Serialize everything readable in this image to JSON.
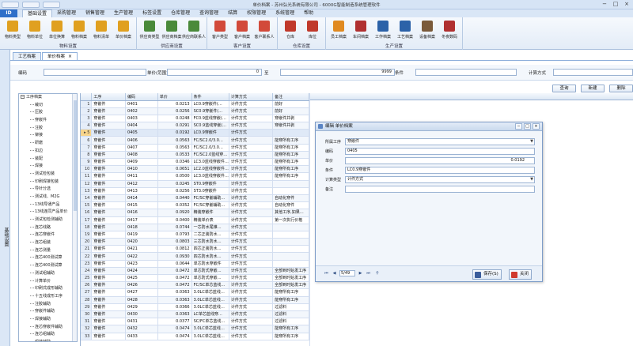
{
  "window": {
    "title": "单价档案 - 苏州弘光系统有限公司 - 6000G智能制造系统管理软件",
    "controls": [
      "−",
      "□",
      "×"
    ]
  },
  "menubar": {
    "app_button": "ID",
    "items": [
      "基础设置",
      "采购管理",
      "销售管理",
      "生产管理",
      "标签设置",
      "仓库管理",
      "查询管理",
      "结算",
      "权限管理",
      "系统管理",
      "帮助"
    ]
  },
  "ribbon": {
    "groups": [
      {
        "label": "物料设置",
        "buttons": [
          {
            "label": "物料类型",
            "icon": "folder-icon",
            "color": "#e0a020"
          },
          {
            "label": "物料单位",
            "icon": "folder-icon",
            "color": "#e0a020"
          },
          {
            "label": "单位换算",
            "icon": "folder-icon",
            "color": "#e0a020"
          },
          {
            "label": "物料档案",
            "icon": "folder-icon",
            "color": "#e0a020"
          },
          {
            "label": "物料清单",
            "icon": "folder-icon",
            "color": "#e0a020"
          },
          {
            "label": "单价档案",
            "icon": "folder-icon",
            "color": "#e0a020"
          }
        ]
      },
      {
        "label": "供应商设置",
        "buttons": [
          {
            "label": "供应商类型",
            "icon": "truck-icon",
            "color": "#4a8a3a"
          },
          {
            "label": "供应商档案",
            "icon": "truck-icon",
            "color": "#4a8a3a"
          },
          {
            "label": "供应商联系人",
            "icon": "truck-icon",
            "color": "#4a8a3a"
          }
        ]
      },
      {
        "label": "客户设置",
        "buttons": [
          {
            "label": "客户类型",
            "icon": "people-icon",
            "color": "#d24a3a"
          },
          {
            "label": "客户档案",
            "icon": "people-icon",
            "color": "#d24a3a"
          },
          {
            "label": "客户联系人",
            "icon": "people-icon",
            "color": "#d24a3a"
          }
        ]
      },
      {
        "label": "仓库设置",
        "buttons": [
          {
            "label": "仓库",
            "icon": "house-icon",
            "color": "#c0392b"
          },
          {
            "label": "库位",
            "icon": "house-icon",
            "color": "#c0392b"
          }
        ]
      },
      {
        "label": "生产设置",
        "buttons": [
          {
            "label": "员工档案",
            "icon": "person-icon",
            "color": "#e08a20"
          },
          {
            "label": "车间档案",
            "icon": "book-icon",
            "color": "#b03030"
          },
          {
            "label": "工作档案",
            "icon": "book-icon",
            "color": "#2c62a8"
          },
          {
            "label": "工艺档案",
            "icon": "book-icon",
            "color": "#2c62a8"
          },
          {
            "label": "设备档案",
            "icon": "book-icon",
            "color": "#7a5a3a"
          },
          {
            "label": "冬夜数码",
            "icon": "book-icon",
            "color": "#b03030"
          }
        ]
      }
    ]
  },
  "sidebar": {
    "label": "基础设置"
  },
  "doc_tabs": [
    {
      "label": "工艺档案",
      "active": false
    },
    {
      "label": "单价档案",
      "active": true
    }
  ],
  "filter": {
    "code_label": "编码",
    "price_range_label": "单价(范围)",
    "price_from": "0",
    "to_label": "至",
    "price_to": "9999",
    "condition_label": "条件",
    "calc_method_label": "计算方式"
  },
  "actions": [
    "查询",
    "新建",
    "删除"
  ],
  "tree": {
    "root": "工序档案",
    "children": [
      "裁切",
      "压胶",
      "穿嵌件",
      "注胶",
      "铆接",
      "研磨",
      "扣边",
      "装配",
      "焊接",
      "测试检包装",
      "印刷焊接包装",
      "导针分选",
      "测试线、M2G",
      "13线导通产品",
      "13线连同产品单价",
      "测试包检测辅助",
      "连芯线路",
      "连芯穿嵌件",
      "连芯组装",
      "连芯测量",
      "连芯400测试算",
      "连芯400测试算",
      "测试组辅助",
      "计算单价",
      "印刷式成形辅助",
      "十五线成形工序",
      "注胶辅助",
      "穿嵌件辅助",
      "焊接辅助",
      "连芯穿嵌件辅助",
      "连芯组辅助",
      "组装辅助",
      "装置辅助"
    ]
  },
  "grid": {
    "columns": [
      "工序",
      "编码",
      "单价",
      "条件",
      "计算方式",
      "备注"
    ],
    "rows": [
      [
        "穿嵌件",
        "0401",
        "0.0213",
        "LC0.9穿嵌件(…",
        "计件方式",
        "前好"
      ],
      [
        "穿嵌件",
        "0402",
        "0.0256",
        "SC0.9穿嵌件(…",
        "计件方式",
        "前好"
      ],
      [
        "穿嵌件",
        "0403",
        "0.0248",
        "FC0.9蓝线穿嵌(…",
        "计件方式",
        "穿嵌件并剥"
      ],
      [
        "穿嵌件",
        "0404",
        "0.0291",
        "SC0.9蓝线穿嵌(…",
        "计件方式",
        "穿嵌件并剥"
      ],
      [
        "穿嵌件",
        "0405",
        "0.0192",
        "LC0.9穿嵌件",
        "计件方式",
        ""
      ],
      [
        "穿嵌件",
        "0406",
        "0.0563",
        "FC/SC2.0/3.0…",
        "计件方式",
        "能穿所有工序"
      ],
      [
        "穿嵌件",
        "0407",
        "0.0563",
        "FC/SC2.0/3.0…",
        "计件方式",
        "能穿所有工序"
      ],
      [
        "穿嵌件",
        "0408",
        "0.0533",
        "FC/SC2.0蓝线穿…",
        "计件方式",
        "能穿所有工序"
      ],
      [
        "穿嵌件",
        "0409",
        "0.0346",
        "LC3.0蓝线穿嵌件…",
        "计件方式",
        "能穿所有工序"
      ],
      [
        "穿嵌件",
        "0410",
        "0.0651",
        "LC2.0蓝线穿嵌件…",
        "计件方式",
        "能穿所有工序"
      ],
      [
        "穿嵌件",
        "0411",
        "0.0500",
        "LC3.0蓝线穿嵌件…",
        "计件方式",
        "能穿所有工序"
      ],
      [
        "穿嵌件",
        "0412",
        "0.0245",
        "ST0.9穿嵌件",
        "计件方式",
        ""
      ],
      [
        "穿嵌件",
        "0413",
        "0.0256",
        "ST3.0穿嵌件",
        "计件方式",
        ""
      ],
      [
        "穿嵌件",
        "0414",
        "0.0440",
        "FC/SC穿嵌辅助…",
        "计件方式",
        "自动化穿件"
      ],
      [
        "穿嵌件",
        "0415",
        "0.0352",
        "FC/SC穿嵌辅助…",
        "计件方式",
        "自动化穿件"
      ],
      [
        "穿嵌件",
        "0416",
        "0.0920",
        "精装穿嵌件",
        "计件方式",
        "其他工序,如果…"
      ],
      [
        "穿嵌件",
        "0417",
        "0.0400",
        "精装单价表",
        "计件方式",
        "第一次执行价格"
      ],
      [
        "穿嵌件",
        "0418",
        "0.0744",
        "一芯防水尾锥…",
        "计件方式",
        ""
      ],
      [
        "穿嵌件",
        "0419",
        "0.0793",
        "二芯正装防水…",
        "计件方式",
        ""
      ],
      [
        "穿嵌件",
        "0420",
        "0.0803",
        "三芯防水防水…",
        "计件方式",
        ""
      ],
      [
        "穿嵌件",
        "0421",
        "0.0812",
        "四芯正装防水…",
        "计件方式",
        ""
      ],
      [
        "穿嵌件",
        "0422",
        "0.0930",
        "四芯防水防水…",
        "计件方式",
        ""
      ],
      [
        "穿嵌件",
        "0423",
        "0.0644",
        "单芯防水穿嵌件",
        "计件方式",
        ""
      ],
      [
        "穿嵌件",
        "0424",
        "0.0472",
        "单芯防式穿嵌…",
        "计件方式",
        "全部到时始发工序"
      ],
      [
        "穿嵌件",
        "0425",
        "0.0472",
        "单芯防式穿嵌…",
        "计件方式",
        "全部到时始发工序"
      ],
      [
        "穿嵌件",
        "0426",
        "0.0472",
        "FC/SC单芯蓝线…",
        "计件方式",
        "全部到时始发工序"
      ],
      [
        "穿嵌件",
        "0427",
        "0.0363",
        "3.0LC单芯蓝线…",
        "计件方式",
        "能穿所有工序"
      ],
      [
        "穿嵌件",
        "0428",
        "0.0363",
        "3.0LC单芯蓝线…",
        "计件方式",
        "能穿所有工序"
      ],
      [
        "穿嵌件",
        "0429",
        "0.0366",
        "3.0LC单芯蓝线…",
        "计件方式",
        "过滤料"
      ],
      [
        "穿嵌件",
        "0430",
        "0.0363",
        "LC单芯蓝线穿…",
        "计件方式",
        "过滤料"
      ],
      [
        "穿嵌件",
        "0431",
        "0.0377",
        "SC/FC单芯蓝线…",
        "计件方式",
        "过滤料"
      ],
      [
        "穿嵌件",
        "0432",
        "0.0474",
        "3.0LC单芯蓝线…",
        "计件方式",
        "能穿所有工序"
      ],
      [
        "穿嵌件",
        "0433",
        "0.0474",
        "3.0LC单芯蓝线…",
        "计件方式",
        "能穿所有工序"
      ]
    ],
    "current_row": 5
  },
  "dialog": {
    "title": "编辑 单价档案",
    "fields": [
      {
        "label": "所属工序",
        "value": "穿嵌件",
        "dropdown": true,
        "numeric": false
      },
      {
        "label": "编码",
        "value": "0405",
        "dropdown": false,
        "numeric": false
      },
      {
        "label": "单价",
        "value": "0.0192",
        "dropdown": false,
        "numeric": true
      },
      {
        "label": "条件",
        "value": "LC0.9穿嵌件",
        "dropdown": false,
        "numeric": false
      },
      {
        "label": "计算类型",
        "value": "计件方式",
        "dropdown": true,
        "numeric": false
      },
      {
        "label": "备注",
        "value": "",
        "dropdown": false,
        "numeric": false
      }
    ],
    "pager": "5/49",
    "save_label": "保存(S)",
    "close_label": "关闭"
  }
}
